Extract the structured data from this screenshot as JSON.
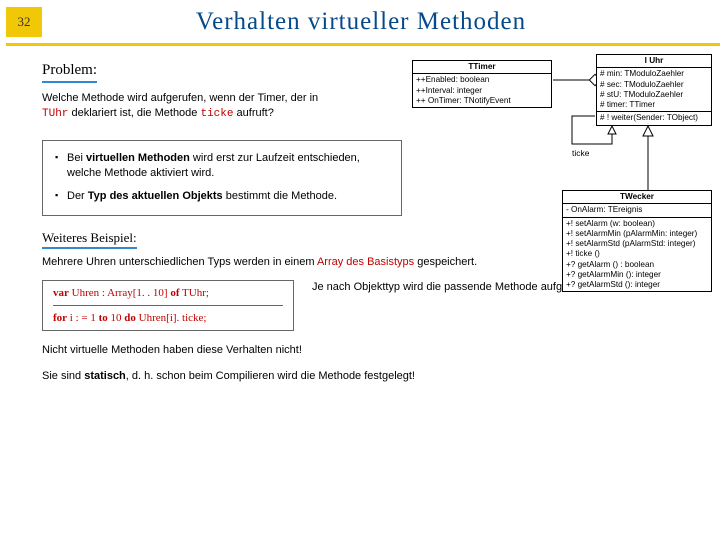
{
  "page_number": "32",
  "title": "Verhalten virtueller Methoden",
  "problem": {
    "heading": "Problem:",
    "line1": "Welche Methode wird aufgerufen, wenn der Timer, der in ",
    "tuhr": "TUhr",
    "line2": " deklariert ist, die Methode ",
    "ticke": "ticke",
    "line3": " aufruft?"
  },
  "bullets": [
    {
      "pre": "Bei ",
      "b": "virtuellen Methoden",
      "post": " wird erst zur Laufzeit entschieden, welche Methode aktiviert wird."
    },
    {
      "pre": "Der ",
      "b": "Typ des aktuellen Objekts",
      "post": " bestimmt die Methode."
    }
  ],
  "weiter": {
    "heading": "Weiteres Beispiel:",
    "line_a": "Mehrere Uhren unterschiedlichen Typs werden in einem ",
    "arr": "Array des Basistyps",
    "line_b": " gespeichert."
  },
  "code": {
    "var_kw": "var",
    "var_rest": " Uhren : Array[1. . 10] ",
    "of_kw": "of",
    "of_rest": " TUhr;",
    "for_kw": "for",
    "for_mid": " i : = 1 ",
    "to_kw": "to",
    "to_mid": " 10 ",
    "do_kw": "do",
    "do_rest": " Uhren[i]. ticke;"
  },
  "after_code": "Je nach Objekttyp wird die passende Methode aufgerufen!",
  "foot1": "Nicht virtuelle Methoden haben diese Verhalten nicht!",
  "foot2_a": "Sie sind ",
  "foot2_b": "statisch",
  "foot2_c": ", d. h. schon beim Compilieren wird die Methode festgelegt!",
  "uml": {
    "ttimer": {
      "name": "TTimer",
      "attrs": "++Enabled: boolean\n++Interval: integer\n++ OnTimer: TNotifyEvent"
    },
    "iuhr": {
      "name": "I Uhr",
      "attrs": "# min: TModuloZaehler\n# sec: TModuloZaehler\n# stU: TModuloZaehler\n# timer: TTimer",
      "ops": "# ! weiter(Sender: TObject)"
    },
    "twecker": {
      "name": "TWecker",
      "attrs": "- OnAlarm: TEreignis",
      "ops": "+! setAlarm (w: boolean)\n+! setAlarmMin (pAlarmMin: integer)\n+! setAlarmStd (pAlarmStd: integer)\n+! ticke ()\n+? getAlarm () : boolean\n+? getAlarmMin (): integer\n+? getAlarmStd (): integer"
    },
    "ticke_label": "ticke"
  }
}
